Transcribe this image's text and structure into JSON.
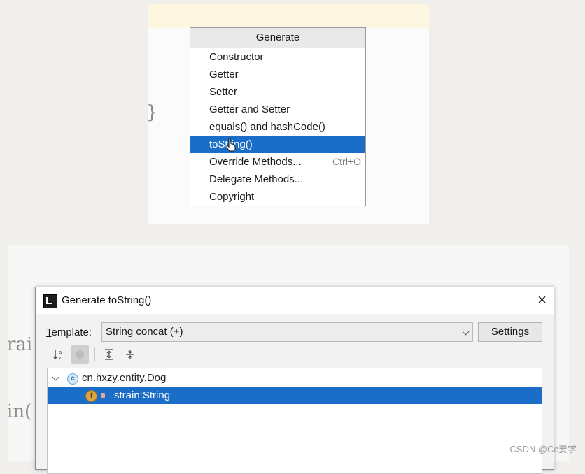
{
  "generate_menu": {
    "title": "Generate",
    "items": [
      {
        "label": "Constructor",
        "shortcut": ""
      },
      {
        "label": "Getter",
        "shortcut": ""
      },
      {
        "label": "Setter",
        "shortcut": ""
      },
      {
        "label": "Getter and Setter",
        "shortcut": ""
      },
      {
        "label": "equals() and hashCode()",
        "shortcut": ""
      },
      {
        "label": "toString()",
        "shortcut": ""
      },
      {
        "label": "Override Methods...",
        "shortcut": "Ctrl+O"
      },
      {
        "label": "Delegate Methods...",
        "shortcut": ""
      },
      {
        "label": "Copyright",
        "shortcut": ""
      }
    ],
    "selected_index": 5
  },
  "background_code": {
    "fragment1": "rai",
    "fragment2": "in("
  },
  "dialog": {
    "title": "Generate toString()",
    "close_icon": "×",
    "template_label_prefix": "T",
    "template_label_rest": "emplate:",
    "template_value": "String concat (+)",
    "settings_label": "Settings",
    "toolbar_icons": [
      "sort-icon",
      "show-members-icon",
      "expand-all-icon",
      "collapse-all-icon"
    ],
    "tree": {
      "class_name": "cn.hxzy.entity.Dog",
      "class_icon_letter": "c",
      "field_icon_letter": "f",
      "fields": [
        "strain:String"
      ]
    }
  },
  "watermark": "CSDN @Cc要学",
  "colors": {
    "selection": "#1a6ec7",
    "popup_header": "#e9e9e9",
    "dialog_bg": "#f2f2f2"
  }
}
